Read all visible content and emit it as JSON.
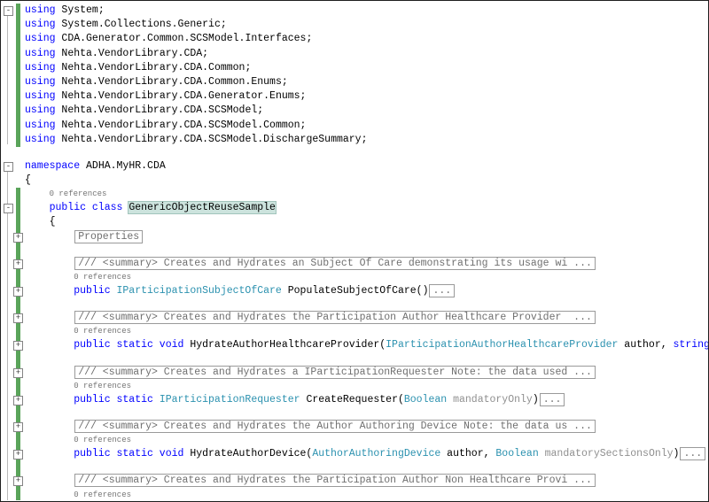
{
  "editor": {
    "app": "code-editor",
    "codelens_label": "0 references",
    "colors": {
      "keyword": "#0000ff",
      "type": "#2b91af",
      "plain": "#000000",
      "collapsed_text": "#6f6f6f",
      "codelens": "#767676",
      "change_bar": "#5aa45a",
      "highlight_bg": "#cce3dd"
    },
    "rows": [
      {
        "k": "code",
        "fold": {
          "col": "a",
          "sym": "-"
        },
        "ind": 0,
        "seg": [
          {
            "c": "kw",
            "t": "using"
          },
          {
            "c": "pl",
            "t": " System;"
          }
        ]
      },
      {
        "k": "code",
        "ind": 0,
        "seg": [
          {
            "c": "kw",
            "t": "using"
          },
          {
            "c": "pl",
            "t": " System.Collections.Generic;"
          }
        ]
      },
      {
        "k": "code",
        "ind": 0,
        "seg": [
          {
            "c": "kw",
            "t": "using"
          },
          {
            "c": "pl",
            "t": " CDA.Generator.Common.SCSModel.Interfaces;"
          }
        ]
      },
      {
        "k": "code",
        "ind": 0,
        "seg": [
          {
            "c": "kw",
            "t": "using"
          },
          {
            "c": "pl",
            "t": " Nehta.VendorLibrary.CDA;"
          }
        ]
      },
      {
        "k": "code",
        "ind": 0,
        "seg": [
          {
            "c": "kw",
            "t": "using"
          },
          {
            "c": "pl",
            "t": " Nehta.VendorLibrary.CDA.Common;"
          }
        ]
      },
      {
        "k": "code",
        "ind": 0,
        "seg": [
          {
            "c": "kw",
            "t": "using"
          },
          {
            "c": "pl",
            "t": " Nehta.VendorLibrary.CDA.Common.Enums;"
          }
        ]
      },
      {
        "k": "code",
        "ind": 0,
        "seg": [
          {
            "c": "kw",
            "t": "using"
          },
          {
            "c": "pl",
            "t": " Nehta.VendorLibrary.CDA.Generator.Enums;"
          }
        ]
      },
      {
        "k": "code",
        "ind": 0,
        "seg": [
          {
            "c": "kw",
            "t": "using"
          },
          {
            "c": "pl",
            "t": " Nehta.VendorLibrary.CDA.SCSModel;"
          }
        ]
      },
      {
        "k": "code",
        "ind": 0,
        "seg": [
          {
            "c": "kw",
            "t": "using"
          },
          {
            "c": "pl",
            "t": " Nehta.VendorLibrary.CDA.SCSModel.Common;"
          }
        ]
      },
      {
        "k": "code",
        "ind": 0,
        "seg": [
          {
            "c": "kw",
            "t": "using"
          },
          {
            "c": "pl",
            "t": " Nehta.VendorLibrary.CDA.SCSModel.DischargeSummary;"
          }
        ]
      },
      {
        "k": "blank"
      },
      {
        "k": "code",
        "fold": {
          "col": "a",
          "sym": "-"
        },
        "ind": 0,
        "seg": [
          {
            "c": "kw",
            "t": "namespace"
          },
          {
            "c": "pl",
            "t": " ADHA.MyHR.CDA"
          }
        ]
      },
      {
        "k": "code",
        "ind": 0,
        "seg": [
          {
            "c": "pl",
            "t": "{"
          }
        ]
      },
      {
        "k": "lens",
        "ind": 4
      },
      {
        "k": "code",
        "fold": {
          "col": "a",
          "sym": "-"
        },
        "ind": 4,
        "seg": [
          {
            "c": "kw",
            "t": "public class "
          },
          {
            "c": "hl",
            "t": "GenericObjectReuseSample"
          }
        ]
      },
      {
        "k": "code",
        "ind": 4,
        "seg": [
          {
            "c": "pl",
            "t": "{"
          }
        ]
      },
      {
        "k": "code",
        "fold": {
          "col": "b",
          "sym": "+"
        },
        "ind": 8,
        "seg": [
          {
            "c": "box",
            "t": "Properties"
          }
        ]
      },
      {
        "k": "blank"
      },
      {
        "k": "code",
        "fold": {
          "col": "b",
          "sym": "+"
        },
        "ind": 8,
        "seg": [
          {
            "c": "box",
            "t": "/// <summary> Creates and Hydrates an Subject Of Care demonstrating its usage wi ..."
          }
        ]
      },
      {
        "k": "lens",
        "ind": 8
      },
      {
        "k": "code",
        "fold": {
          "col": "b",
          "sym": "+"
        },
        "ind": 8,
        "seg": [
          {
            "c": "kw",
            "t": "public "
          },
          {
            "c": "ty",
            "t": "IParticipationSubjectOfCare"
          },
          {
            "c": "pl",
            "t": " PopulateSubjectOfCare()"
          },
          {
            "c": "box",
            "t": "..."
          }
        ]
      },
      {
        "k": "blank"
      },
      {
        "k": "code",
        "fold": {
          "col": "b",
          "sym": "+"
        },
        "ind": 8,
        "seg": [
          {
            "c": "box",
            "t": "/// <summary> Creates and Hydrates the Participation Author Healthcare Provider  ..."
          }
        ]
      },
      {
        "k": "lens",
        "ind": 8
      },
      {
        "k": "code",
        "fold": {
          "col": "b",
          "sym": "+"
        },
        "ind": 8,
        "seg": [
          {
            "c": "kw",
            "t": "public static void "
          },
          {
            "c": "pl",
            "t": "HydrateAuthorHealthcareProvider("
          },
          {
            "c": "ty",
            "t": "IParticipationAuthorHealthcareProvider"
          },
          {
            "c": "pl",
            "t": " author, "
          },
          {
            "c": "kw",
            "t": "string"
          },
          {
            "c": "pl",
            "t": " g"
          }
        ]
      },
      {
        "k": "blank"
      },
      {
        "k": "code",
        "fold": {
          "col": "b",
          "sym": "+"
        },
        "ind": 8,
        "seg": [
          {
            "c": "box",
            "t": "/// <summary> Creates and Hydrates a IParticipationRequester Note: the data used ..."
          }
        ]
      },
      {
        "k": "lens",
        "ind": 8
      },
      {
        "k": "code",
        "fold": {
          "col": "b",
          "sym": "+"
        },
        "ind": 8,
        "seg": [
          {
            "c": "kw",
            "t": "public static "
          },
          {
            "c": "ty",
            "t": "IParticipationRequester"
          },
          {
            "c": "pl",
            "t": " CreateRequester("
          },
          {
            "c": "ty",
            "t": "Boolean"
          },
          {
            "c": "gy",
            "t": " mandatoryOnly"
          },
          {
            "c": "pl",
            "t": ")"
          },
          {
            "c": "box",
            "t": "..."
          }
        ]
      },
      {
        "k": "blank"
      },
      {
        "k": "code",
        "fold": {
          "col": "b",
          "sym": "+"
        },
        "ind": 8,
        "seg": [
          {
            "c": "box",
            "t": "/// <summary> Creates and Hydrates the Author Authoring Device Note: the data us ..."
          }
        ]
      },
      {
        "k": "lens",
        "ind": 8
      },
      {
        "k": "code",
        "fold": {
          "col": "b",
          "sym": "+"
        },
        "ind": 8,
        "seg": [
          {
            "c": "kw",
            "t": "public static void "
          },
          {
            "c": "pl",
            "t": "HydrateAuthorDevice("
          },
          {
            "c": "ty",
            "t": "AuthorAuthoringDevice"
          },
          {
            "c": "pl",
            "t": " author, "
          },
          {
            "c": "ty",
            "t": "Boolean"
          },
          {
            "c": "gy",
            "t": " mandatorySectionsOnly"
          },
          {
            "c": "pl",
            "t": ")"
          },
          {
            "c": "box",
            "t": "..."
          }
        ]
      },
      {
        "k": "blank"
      },
      {
        "k": "code",
        "fold": {
          "col": "b",
          "sym": "+"
        },
        "ind": 8,
        "seg": [
          {
            "c": "box",
            "t": "/// <summary> Creates and Hydrates the Participation Author Non Healthcare Provi ..."
          }
        ]
      },
      {
        "k": "lens",
        "ind": 8
      }
    ]
  }
}
